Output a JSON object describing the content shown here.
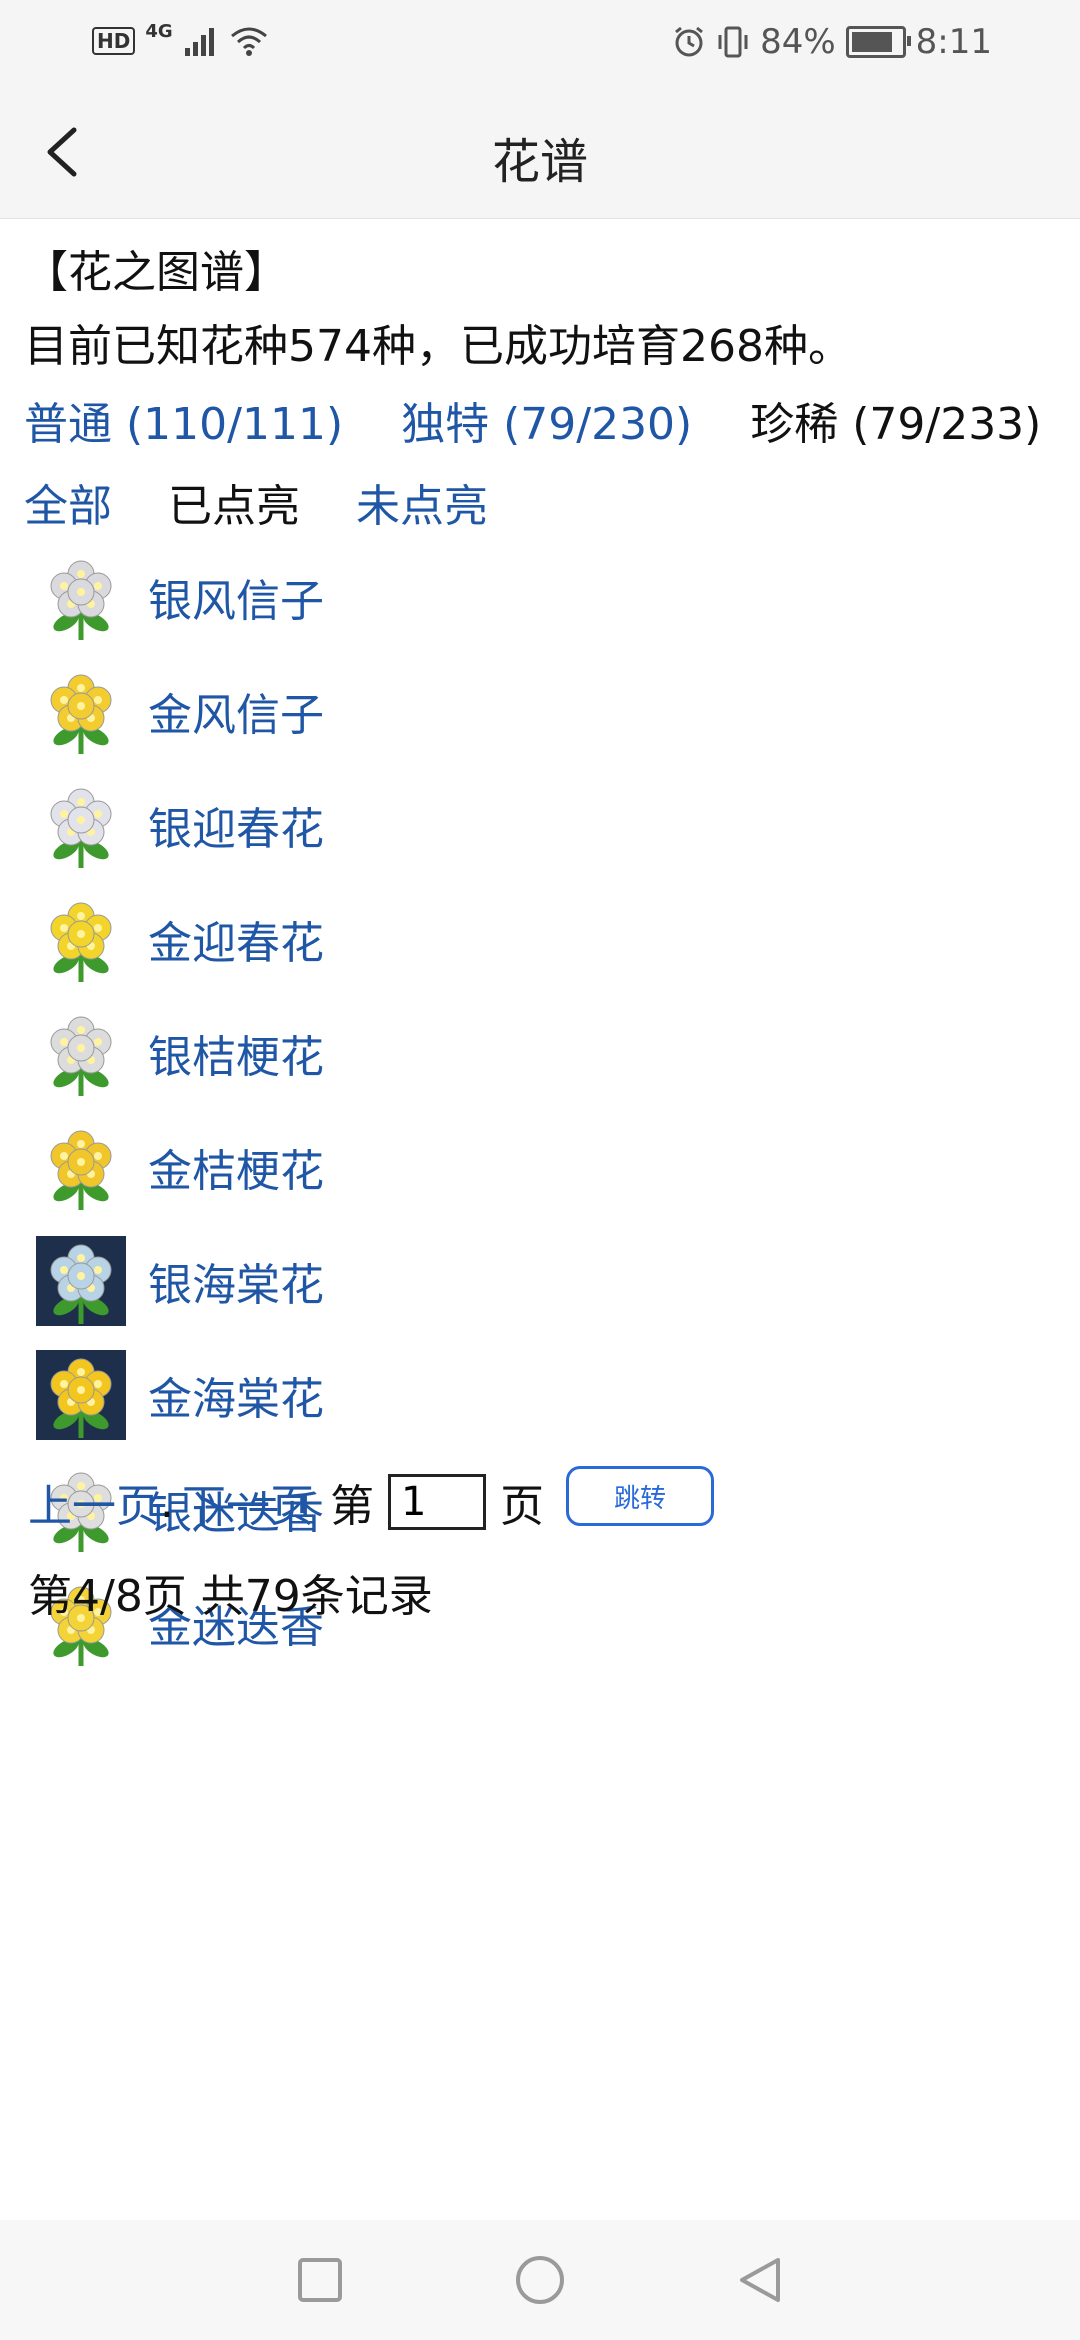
{
  "status_bar": {
    "network": "4G",
    "hd": "HD",
    "battery": "84%",
    "battery_level": 0.84,
    "time": "8:11"
  },
  "header": {
    "title": "花谱"
  },
  "intro": {
    "heading": "【花之图谱】",
    "summary": "目前已知花种574种，已成功培育268种。"
  },
  "categories": [
    {
      "label": "普通 (110/111)",
      "link": true
    },
    {
      "label": "独特 (79/230)",
      "link": true
    },
    {
      "label": "珍稀 (79/233)",
      "link": false
    }
  ],
  "filters": [
    {
      "label": "全部",
      "link": true
    },
    {
      "label": "已点亮",
      "link": false
    },
    {
      "label": "未点亮",
      "link": true
    }
  ],
  "flowers": [
    {
      "name": "银风信子",
      "variant": "silver",
      "color": "#d9d9de"
    },
    {
      "name": "金风信子",
      "variant": "gold",
      "color": "#f3cc2f"
    },
    {
      "name": "银迎春花",
      "variant": "silver",
      "color": "#e2e2ea"
    },
    {
      "name": "金迎春花",
      "variant": "gold",
      "color": "#f2d42a"
    },
    {
      "name": "银桔梗花",
      "variant": "silver",
      "color": "#dcdcdc"
    },
    {
      "name": "金桔梗花",
      "variant": "gold",
      "color": "#f1c62b"
    },
    {
      "name": "银海棠花",
      "variant": "silver-night",
      "color": "#b8d3e6"
    },
    {
      "name": "金海棠花",
      "variant": "gold-night",
      "color": "#f2c61f"
    },
    {
      "name": "银迷迭香",
      "variant": "silver",
      "color": "#dedede"
    },
    {
      "name": "金迷迭香",
      "variant": "gold",
      "color": "#f4d336"
    }
  ],
  "pager": {
    "prev": "上一页",
    "sep": ".",
    "next": "下一页",
    "page_label": "第",
    "page_value": "1",
    "page_suffix": "页",
    "jump": "跳转",
    "summary": "第4/8页 共79条记录"
  },
  "colors": {
    "link": "#1f56a5",
    "button": "#2a6ad8",
    "header_bg": "#f5f5f5"
  }
}
